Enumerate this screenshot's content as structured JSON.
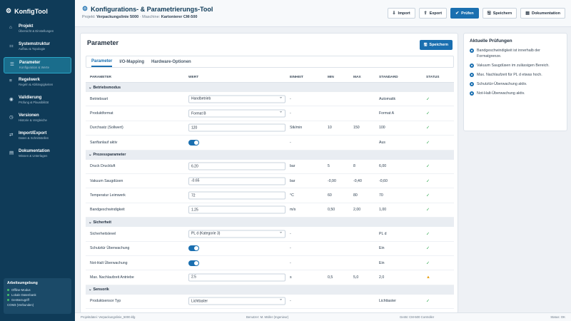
{
  "app": {
    "name": "KonfigTool"
  },
  "sidebar": {
    "items": [
      {
        "title": "Projekt",
        "sub": "Übersicht & Einstellungen",
        "icon": "home-icon"
      },
      {
        "title": "Systemstruktur",
        "sub": "Aufbau & Topologie",
        "icon": "structure-icon"
      },
      {
        "title": "Parameter",
        "sub": "Konfiguration & Werte",
        "icon": "parameter-icon"
      },
      {
        "title": "Regelwerk",
        "sub": "Regeln & Abhängigkeiten",
        "icon": "rules-icon"
      },
      {
        "title": "Validierung",
        "sub": "Prüfung & Plausibilität",
        "icon": "validation-icon"
      },
      {
        "title": "Versionen",
        "sub": "Historie & Vergleiche",
        "icon": "history-icon"
      },
      {
        "title": "Import/Export",
        "sub": "Daten & Schnittstellen",
        "icon": "transfer-icon"
      },
      {
        "title": "Dokumentation",
        "sub": "Wissen & Unterlagen",
        "icon": "book-icon"
      }
    ],
    "env": {
      "title": "Arbeitsumgebung",
      "rows": [
        "Offline-Modus",
        "Lokale Datenbank",
        "Gerätezugriff",
        "COM3 (Verbunden)"
      ]
    }
  },
  "header": {
    "title": "Konfigurations- & Parametrierungs-Tool",
    "project_label": "Projekt:",
    "project": "Verpackungslinie 5000",
    "machine_label": "Maschine:",
    "machine": "Kartonierer CM-500",
    "buttons": {
      "import": "Import",
      "export": "Export",
      "check": "Prüfen",
      "save": "Speichern",
      "docs": "Dokumentation"
    }
  },
  "main": {
    "title": "Parameter",
    "save": "Speichern",
    "tabs": [
      "Parameter",
      "I/O-Mapping",
      "Hardware-Optionen"
    ],
    "columns": {
      "param": "PARAMETER",
      "wert": "WERT",
      "einheit": "EINHEIT",
      "min": "MIN",
      "max": "MAX",
      "std": "STANDARD",
      "status": "STATUS"
    },
    "sections": [
      {
        "name": "Betriebsmodus",
        "rows": [
          {
            "p": "Betriebsart",
            "type": "select",
            "v": "Handbetrieb",
            "u": "-",
            "min": "",
            "max": "",
            "std": "Automatik",
            "status": "ok"
          },
          {
            "p": "Produktformat",
            "type": "select",
            "v": "Format B",
            "u": "-",
            "min": "",
            "max": "",
            "std": "Format A",
            "status": "ok"
          },
          {
            "p": "Durchsatz (Sollwert)",
            "type": "input",
            "v": "120",
            "u": "Stk/min",
            "min": "10",
            "max": "150",
            "std": "100",
            "status": "ok"
          },
          {
            "p": "Sanftanlauf aktiv",
            "type": "toggle",
            "v": "",
            "u": "-",
            "min": "",
            "max": "",
            "std": "Aus",
            "status": "ok"
          }
        ]
      },
      {
        "name": "Prozessparameter",
        "rows": [
          {
            "p": "Druck Druckluft",
            "type": "input",
            "v": "6.20",
            "u": "bar",
            "min": "5",
            "max": "8",
            "std": "6,00",
            "status": "ok"
          },
          {
            "p": "Vakuum Saugdüsen",
            "type": "input",
            "v": "-0.65",
            "u": "bar",
            "min": "-0,90",
            "max": "-0,40",
            "std": "-0,60",
            "status": "ok"
          },
          {
            "p": "Temperatur Leimwerk",
            "type": "input",
            "v": "72",
            "u": "°C",
            "min": "60",
            "max": "80",
            "std": "70",
            "status": "ok"
          },
          {
            "p": "Bandgeschwindigkeit",
            "type": "input",
            "v": "1.25",
            "u": "m/s",
            "min": "0,50",
            "max": "2,00",
            "std": "1,00",
            "status": "ok"
          }
        ]
      },
      {
        "name": "Sicherheit",
        "rows": [
          {
            "p": "Sicherheitslevel",
            "type": "select",
            "v": "PL d (Kategorie 3)",
            "u": "-",
            "min": "",
            "max": "",
            "std": "PL d",
            "status": "ok"
          },
          {
            "p": "Schutztür Überwachung",
            "type": "toggle",
            "v": "",
            "u": "-",
            "min": "",
            "max": "",
            "std": "Ein",
            "status": "ok"
          },
          {
            "p": "Not-Halt Überwachung",
            "type": "toggle",
            "v": "",
            "u": "-",
            "min": "",
            "max": "",
            "std": "Ein",
            "status": "ok"
          },
          {
            "p": "Max. Nachlaufzeit Antriebe",
            "type": "input",
            "v": "2.5",
            "u": "s",
            "min": "0,5",
            "max": "5,0",
            "std": "2,0",
            "status": "warn"
          }
        ]
      },
      {
        "name": "Sensorik",
        "rows": [
          {
            "p": "Produktsensor Typ",
            "type": "select",
            "v": "Lichttaster",
            "u": "-",
            "min": "",
            "max": "",
            "std": "Lichttaster",
            "status": "ok"
          }
        ]
      }
    ]
  },
  "panel": {
    "title": "Aktuelle Prüfungen",
    "items": [
      "Bandgeschwindigkeit ist innerhalb der Formatgrenze.",
      "Vakuum Saugdüsen im zulässigen Bereich.",
      "Max. Nachlaufzeit für PL d etwas hoch.",
      "Schutztür-Überwachung aktiv.",
      "Not-Halt-Überwachung aktiv."
    ]
  },
  "footer": {
    "file": "Projektdatei: Verpackungslinie_5000.kfg",
    "user": "Benutzer: M. Müller (Ingenieur)",
    "device": "Gerät: CM-500 Controller",
    "status": "Status: OK"
  }
}
